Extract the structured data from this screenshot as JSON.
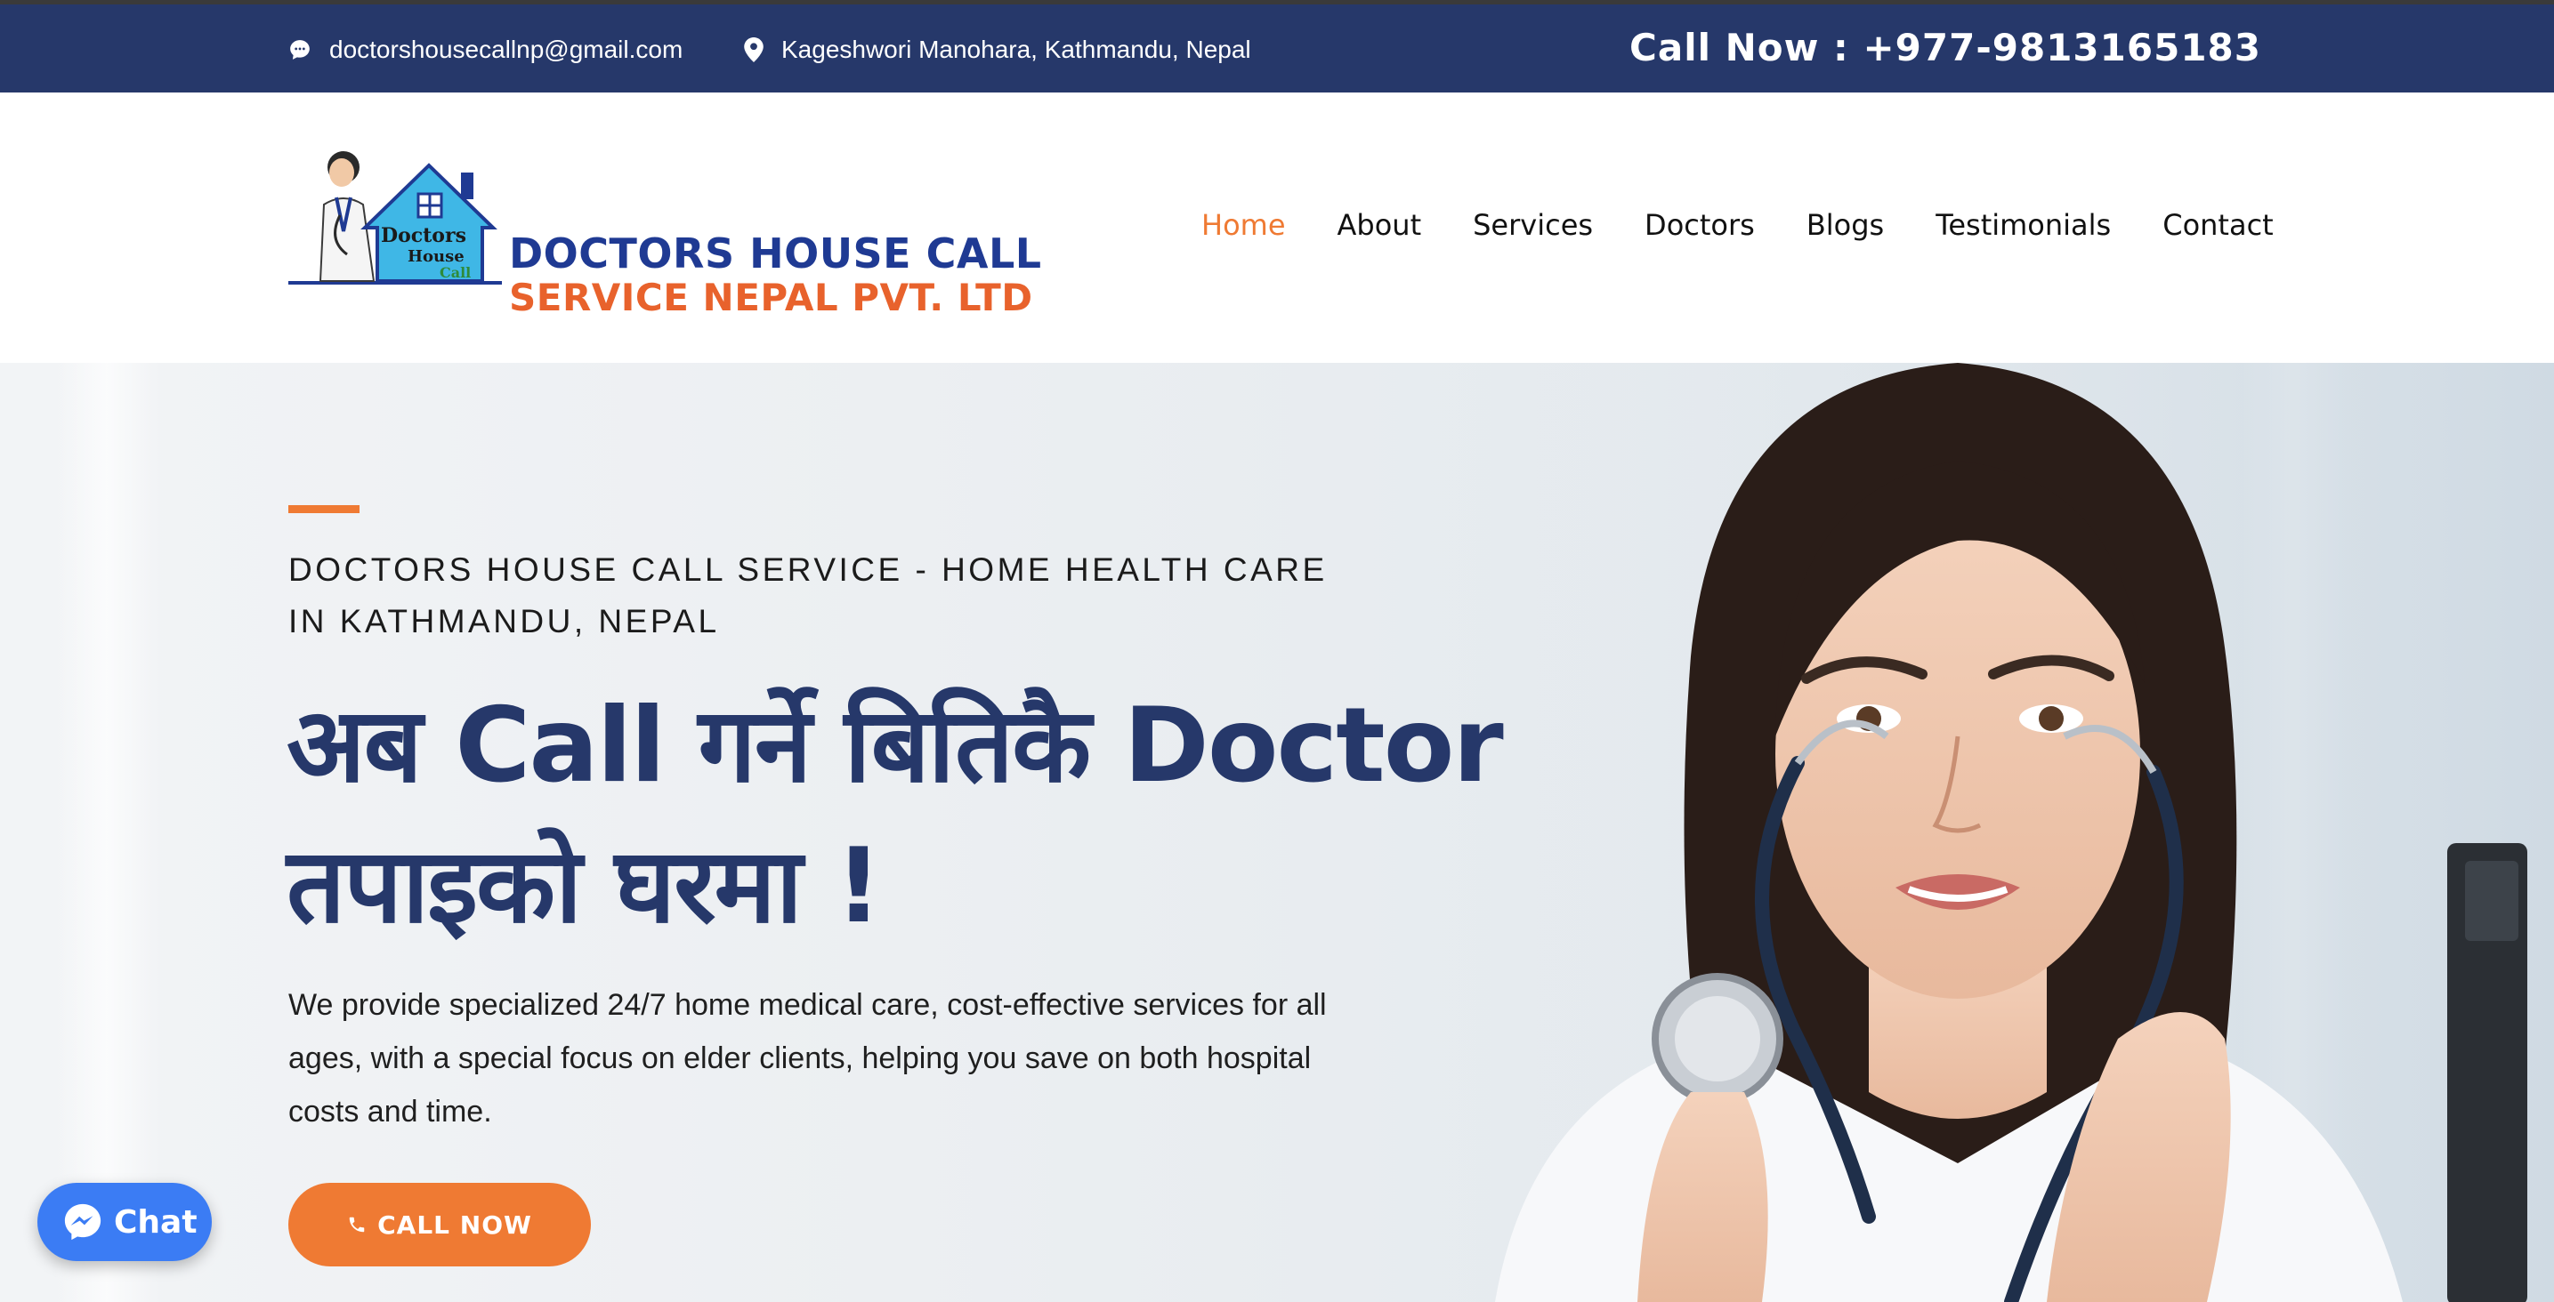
{
  "topbar": {
    "email": "doctorshousecallnp@gmail.com",
    "address": "Kageshwori Manohara, Kathmandu, Nepal",
    "call_now": "Call Now : +977-9813165183",
    "background_color": "#26386a"
  },
  "header": {
    "logo": {
      "line1": "DOCTORS HOUSE CALL",
      "line2": "SERVICE NEPAL PVT. LTD",
      "emblem_text_1": "Doctors",
      "emblem_text_2": "House",
      "emblem_text_3": "Call"
    },
    "nav": [
      {
        "label": "Home",
        "active": true
      },
      {
        "label": "About"
      },
      {
        "label": "Services"
      },
      {
        "label": "Doctors"
      },
      {
        "label": "Blogs"
      },
      {
        "label": "Testimonials"
      },
      {
        "label": "Contact"
      }
    ]
  },
  "hero": {
    "subtitle": "DOCTORS HOUSE CALL SERVICE - HOME HEALTH CARE IN KATHMANDU, NEPAL",
    "title": "अब Call गर्ने बितिकै Doctor तपाइको घरमा !",
    "description": "We provide specialized 24/7 home medical care, cost-effective services for all ages, with a special focus on elder clients, helping you save on both hospital costs and time.",
    "cta_label": "CALL NOW",
    "accent_color": "#ef7a33",
    "title_color": "#26386a"
  },
  "chat_widget": {
    "label": "Chat",
    "color": "#3b7cf4"
  },
  "icons": {
    "email": "chat-bubble-icon",
    "address": "map-pin-icon",
    "cta": "phone-icon",
    "chat": "messenger-icon"
  }
}
